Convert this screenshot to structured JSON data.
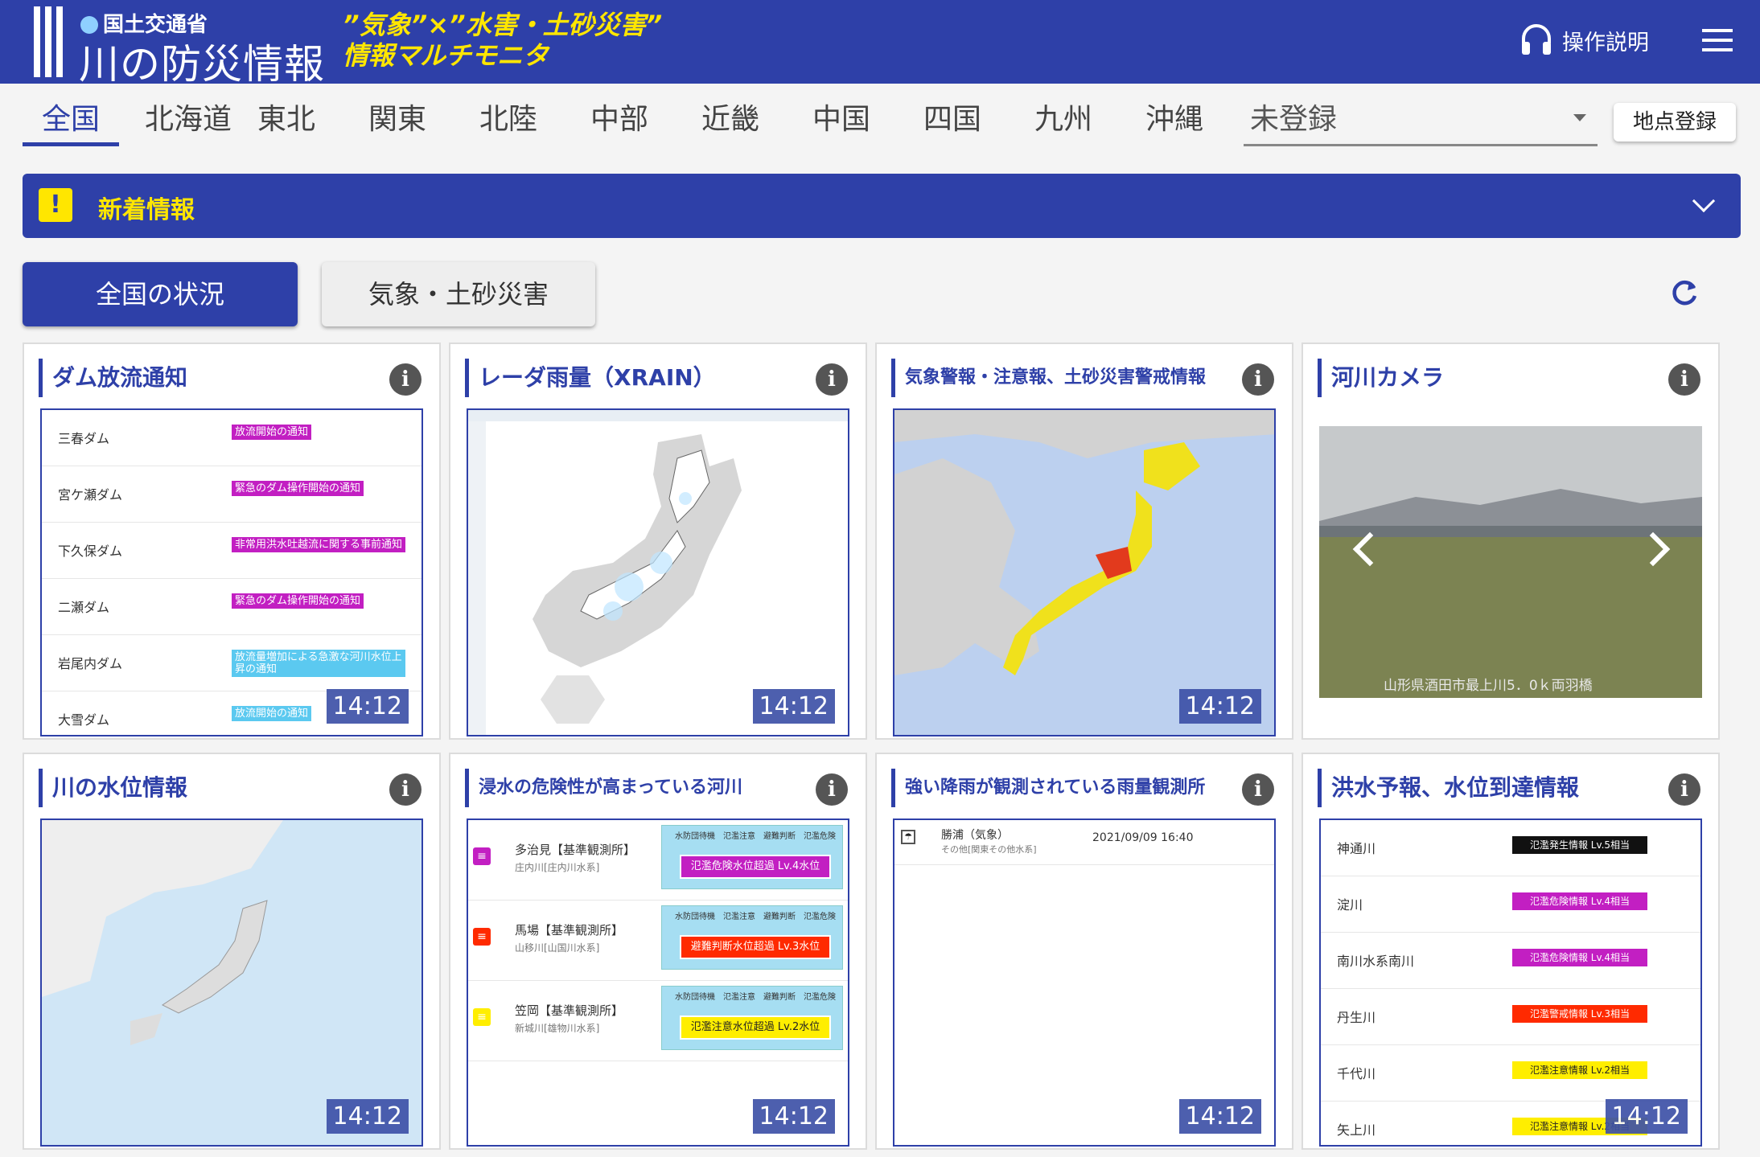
{
  "header": {
    "ministry": "国土交通省",
    "app_title": "川の防災情報",
    "subtitle_line1": "”気象”×”水害・土砂災害”",
    "subtitle_line2": "情報マルチモニタ",
    "help_label": "操作説明"
  },
  "regions": {
    "tabs": [
      "全国",
      "北海道",
      "東北",
      "関東",
      "北陸",
      "中部",
      "近畿",
      "中国",
      "四国",
      "九州",
      "沖縄"
    ],
    "active": "全国",
    "select_value": "未登録",
    "register_button": "地点登録"
  },
  "news": {
    "title": "新着情報"
  },
  "view_buttons": {
    "national": "全国の状況",
    "weather": "気象・土砂災害"
  },
  "cards": {
    "dam": {
      "title": "ダム放流通知",
      "time": "14:12",
      "rows": [
        {
          "name": "三春ダム",
          "tag": "放流開始の通知",
          "color": "#c21fc2"
        },
        {
          "name": "宮ケ瀬ダム",
          "tag": "緊急のダム操作開始の通知",
          "color": "#c21fc2"
        },
        {
          "name": "下久保ダム",
          "tag": "非常用洪水吐越流に関する事前通知",
          "color": "#c21fc2"
        },
        {
          "name": "二瀬ダム",
          "tag": "緊急のダム操作開始の通知",
          "color": "#c21fc2"
        },
        {
          "name": "岩尾内ダム",
          "tag": "放流量増加による急激な河川水位上昇の通知",
          "color": "#5bc9f0"
        },
        {
          "name": "大雪ダム",
          "tag": "放流開始の通知",
          "color": "#5bc9f0"
        }
      ]
    },
    "radar": {
      "title": "レーダ雨量（XRAIN）",
      "time": "14:12"
    },
    "warning": {
      "title": "気象警報・注意報、土砂災害警戒情報",
      "time": "14:12"
    },
    "camera": {
      "title": "河川カメラ",
      "caption": "山形県酒田市最上川5．0ｋ両羽橋"
    },
    "water_level": {
      "title": "川の水位情報",
      "time": "14:12"
    },
    "inundation": {
      "title": "浸水の危険性が高まっている河川",
      "time": "14:12",
      "level_labels": [
        "水防団待機",
        "氾濫注意",
        "避難判断",
        "氾濫危険"
      ],
      "rows": [
        {
          "name": "多治見【基準観測所】",
          "river": "庄内川[庄内川水系]",
          "status": "氾濫危険水位超過 Lv.4水位",
          "color": "#c21fc2",
          "text_color": "#ffffff"
        },
        {
          "name": "馬場【基準観測所】",
          "river": "山移川[山国川水系]",
          "status": "避難判断水位超過 Lv.3水位",
          "color": "#ff2a00",
          "text_color": "#ffffff"
        },
        {
          "name": "笠岡【基準観測所】",
          "river": "新城川[雄物川水系]",
          "status": "氾濫注意水位超過 Lv.2水位",
          "color": "#ffee00",
          "text_color": "#222222"
        }
      ]
    },
    "heavy_rain": {
      "title": "強い降雨が観測されている雨量観測所",
      "time": "14:12",
      "rows": [
        {
          "name": "勝浦（気象）",
          "sub": "その他[関東その他水系]",
          "datetime": "2021/09/09 16:40"
        }
      ]
    },
    "forecast": {
      "title": "洪水予報、水位到達情報",
      "time": "14:12",
      "rows": [
        {
          "name": "神通川",
          "tag": "氾濫発生情報 Lv.5相当",
          "color": "#111111",
          "text_color": "#ffffff"
        },
        {
          "name": "淀川",
          "tag": "氾濫危険情報 Lv.4相当",
          "color": "#c21fc2",
          "text_color": "#ffffff"
        },
        {
          "name": "南川水系南川",
          "tag": "氾濫危険情報 Lv.4相当",
          "color": "#c21fc2",
          "text_color": "#ffffff"
        },
        {
          "name": "丹生川",
          "tag": "氾濫警戒情報 Lv.3相当",
          "color": "#ff2a00",
          "text_color": "#ffffff"
        },
        {
          "name": "千代川",
          "tag": "氾濫注意情報 Lv.2相当",
          "color": "#ffee00",
          "text_color": "#222222"
        },
        {
          "name": "矢上川",
          "tag": "氾濫注意情報 Lv.2相当",
          "color": "#ffee00",
          "text_color": "#222222"
        }
      ]
    }
  }
}
